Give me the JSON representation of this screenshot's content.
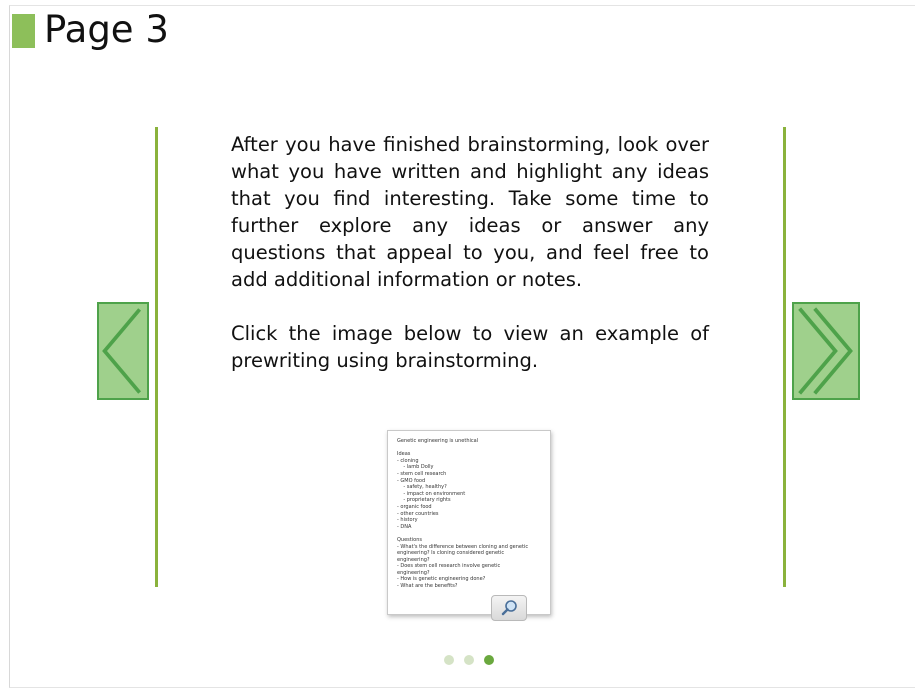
{
  "page": {
    "title": "Page 3"
  },
  "content": {
    "paragraph1": "After you have finished brainstorming, look over what you have written and highlight any ideas that you find interesting. Take some time to further explore any ideas or answer any questions that appeal to you, and feel free to add additional information or notes.",
    "paragraph2": "Click the image below to view an example of prewriting using brainstorming."
  },
  "thumbnail": {
    "lines": [
      "Genetic engineering is unethical",
      "",
      "Ideas",
      "- cloning",
      "    - lamb Dolly",
      "- stem cell research",
      "- GMO food",
      "    - safety, healthy?",
      "    - impact on environment",
      "    - proprietary rights",
      "- organic food",
      "- other countries",
      "- history",
      "- DNA",
      "",
      "Questions",
      "- What's the difference between cloning and genetic",
      "engineering? Is cloning considered genetic",
      "engineering?",
      "- Does stem cell research involve genetic",
      "engineering?",
      "- How is genetic engineering done?",
      "- What are the benefits?"
    ]
  },
  "navigation": {
    "prev_icon": "chevron-left-icon",
    "next_icon": "double-chevron-right-icon",
    "pages": [
      {
        "active": false
      },
      {
        "active": false
      },
      {
        "active": true
      }
    ]
  },
  "colors": {
    "accent": "#8dbf5a",
    "line": "#8ab23c",
    "nav_fill": "#9fd08c",
    "nav_stroke": "#4ea24a",
    "dot_inactive": "#d5e3c6",
    "dot_active": "#6aa83e"
  }
}
